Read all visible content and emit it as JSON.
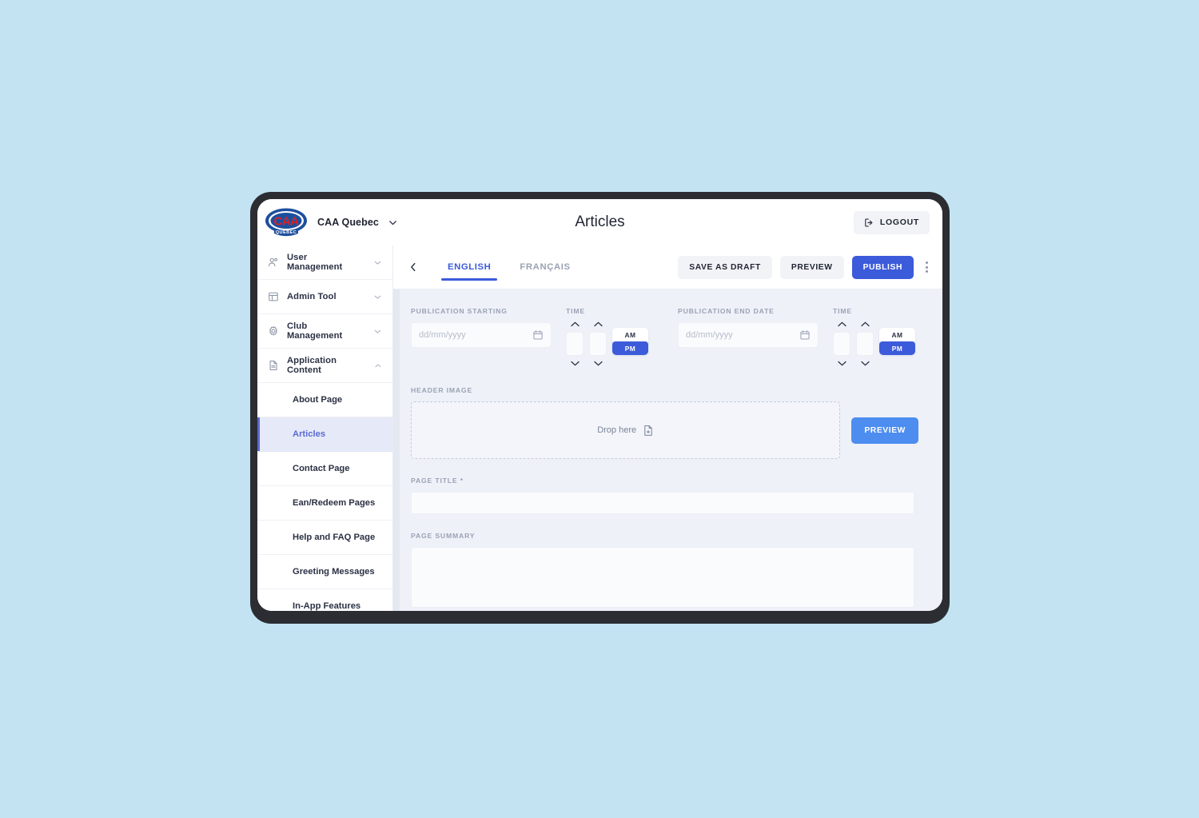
{
  "brand": {
    "logo_icon": "caa-quebec-logo",
    "logo_text_main": "CAA",
    "logo_text_sub": "QUEBEC",
    "name": "CAA Quebec",
    "dropdown_icon": "chevron-down-icon"
  },
  "header": {
    "title": "Articles",
    "logout_label": "LOGOUT",
    "logout_icon": "logout-arrow-icon"
  },
  "sidebar": {
    "groups": [
      {
        "label": "User Management",
        "icon": "users-icon",
        "chevron": "chevron-down-icon",
        "expanded": false
      },
      {
        "label": "Admin Tool",
        "icon": "layout-panel-icon",
        "chevron": "chevron-down-icon",
        "expanded": false
      },
      {
        "label": "Club Management",
        "icon": "gear-icon",
        "chevron": "chevron-down-icon",
        "expanded": false
      },
      {
        "label": "Application Content",
        "icon": "document-icon",
        "chevron": "chevron-up-icon",
        "expanded": true
      }
    ],
    "sub_items": [
      {
        "label": "About Page",
        "active": false
      },
      {
        "label": "Articles",
        "active": true
      },
      {
        "label": "Contact Page",
        "active": false
      },
      {
        "label": "Ean/Redeem Pages",
        "active": false
      },
      {
        "label": "Help and FAQ Page",
        "active": false
      },
      {
        "label": "Greeting Messages",
        "active": false
      },
      {
        "label": "In-App Features",
        "active": false
      }
    ]
  },
  "toolbar": {
    "back_icon": "chevron-left-icon",
    "tabs": [
      {
        "label": "ENGLISH",
        "active": true
      },
      {
        "label": "FRANÇAIS",
        "active": false
      }
    ],
    "save_draft_label": "SAVE AS DRAFT",
    "preview_label": "PREVIEW",
    "publish_label": "PUBLISH",
    "menu_icon": "kebab-menu-icon"
  },
  "form": {
    "publication_starting_label": "PUBLICATION STARTING",
    "publication_start_placeholder": "dd/mm/yyyy",
    "publication_start_value": "",
    "publication_end_label": "PUBLICATION END DATE",
    "publication_end_placeholder": "dd/mm/yyyy",
    "publication_end_value": "",
    "time_label": "TIME",
    "time_start": {
      "hour": "",
      "minute": "",
      "meridiem_selected": "PM",
      "am_label": "AM",
      "pm_label": "PM"
    },
    "time_end": {
      "hour": "",
      "minute": "",
      "meridiem_selected": "PM",
      "am_label": "AM",
      "pm_label": "PM"
    },
    "calendar_icon": "calendar-icon",
    "header_image_label": "HEADER IMAGE",
    "drop_text": "Drop here",
    "drop_icon": "file-add-icon",
    "image_preview_label": "PREVIEW",
    "page_title_label": "PAGE TITLE *",
    "page_title_value": "",
    "page_summary_label": "PAGE SUMMARY",
    "page_summary_value": ""
  },
  "colors": {
    "page_background": "#c3e3f2",
    "device_frame": "#2b2d33",
    "accent_blue": "#3b5bdb",
    "preview_blue": "#4d8df0",
    "content_background": "#eef1f8",
    "active_nav_background": "#e6eaf8",
    "active_nav_text": "#5b6ad0",
    "logo_blue": "#1d4f9e",
    "logo_red": "#e02020"
  }
}
